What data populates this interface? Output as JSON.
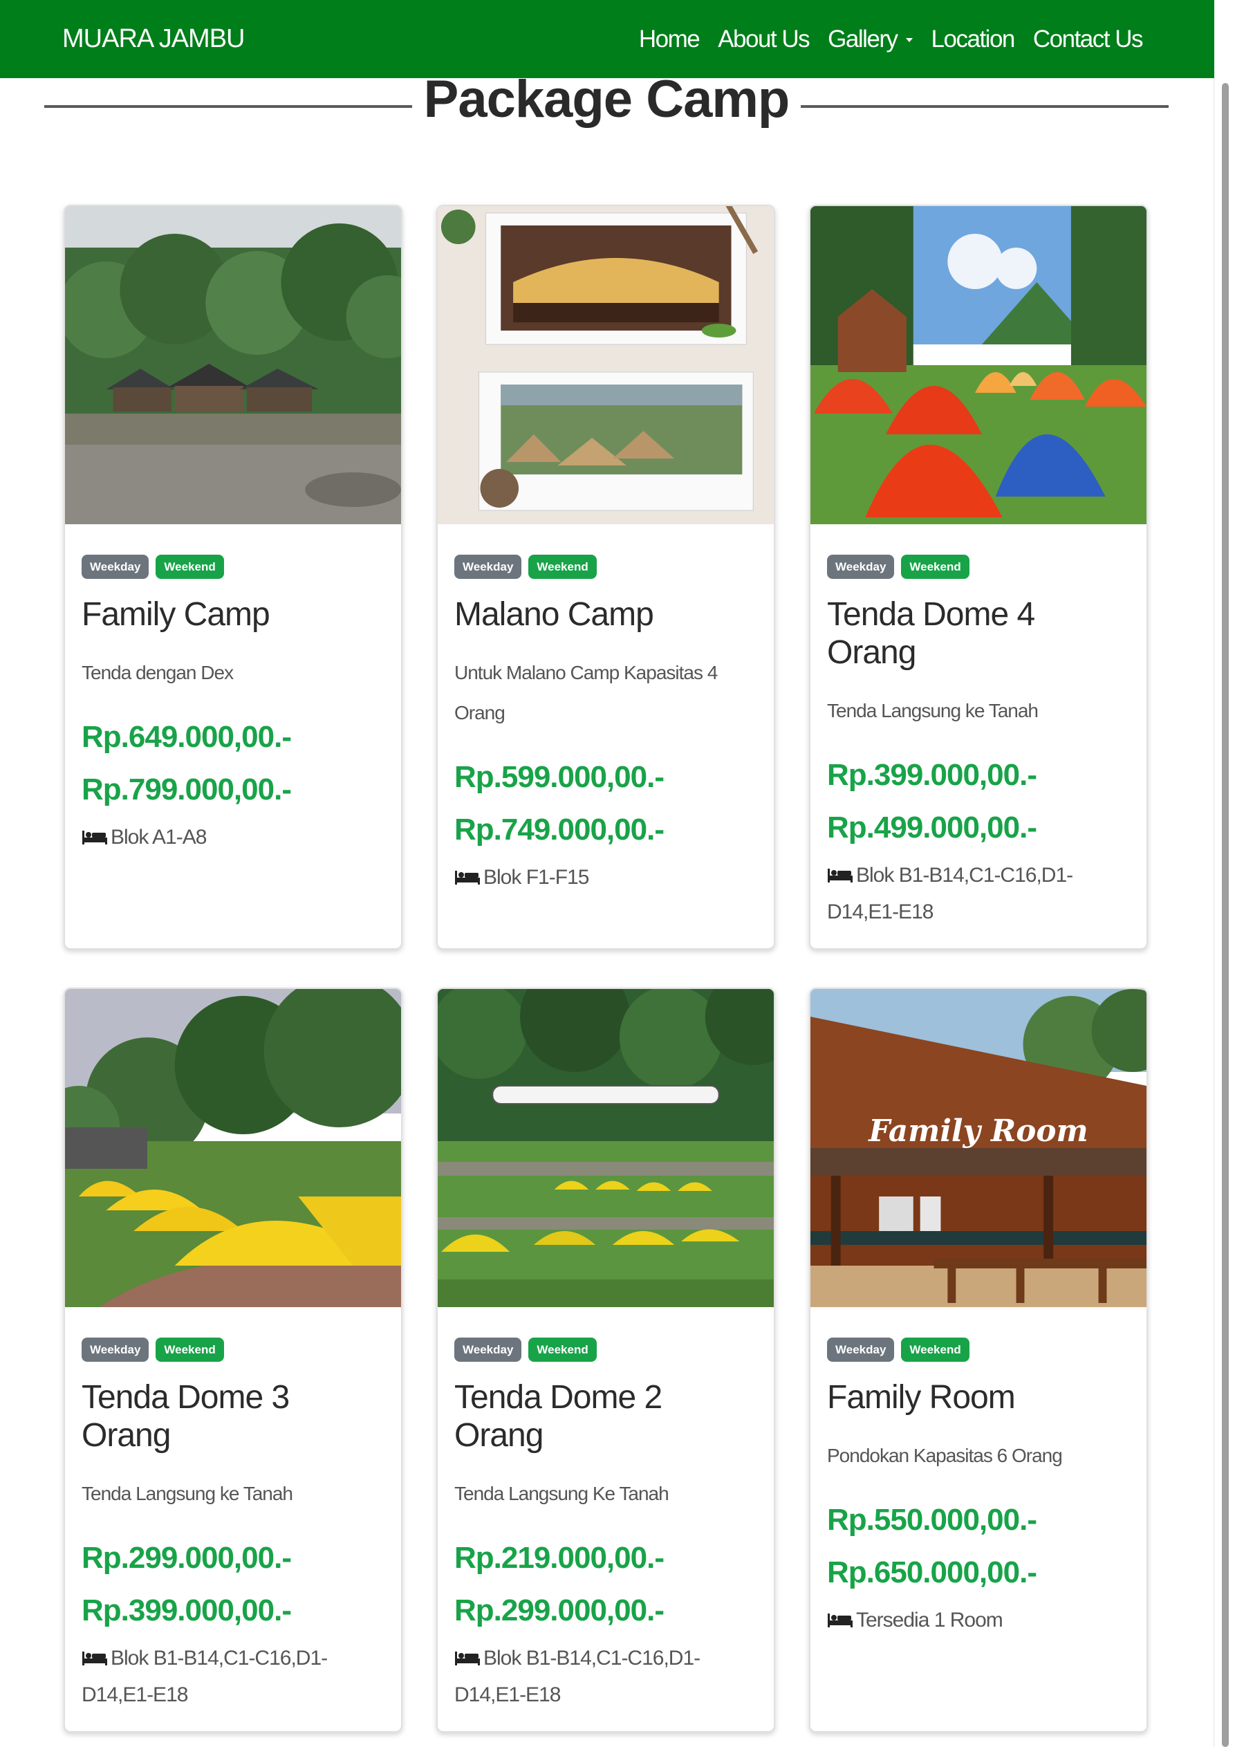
{
  "navbar": {
    "brand": "MUARA JAMBU",
    "links": [
      "Home",
      "About Us",
      "Gallery",
      "Location",
      "Contact Us"
    ]
  },
  "section": {
    "title": "Package Camp"
  },
  "cards": [
    {
      "badge_weekday": "Weekday",
      "badge_weekend": "Weekend",
      "title": "Family Camp",
      "description": "Tenda dengan Dex",
      "price_weekday": "Rp.649.000,00.-",
      "price_weekend": "Rp.799.000,00.-",
      "location": "Blok A1-A8",
      "image": "village-lodge-photo"
    },
    {
      "badge_weekday": "Weekday",
      "badge_weekend": "Weekend",
      "title": "Malano Camp",
      "description": "Untuk Malano Camp Kapasitas 4 Orang",
      "price_weekday": "Rp.599.000,00.-",
      "price_weekend": "Rp.749.000,00.-",
      "location": "Blok F1-F15",
      "image": "tent-collage-photo"
    },
    {
      "badge_weekday": "Weekday",
      "badge_weekend": "Weekend",
      "title": "Tenda Dome 4 Orang",
      "description": "Tenda Langsung ke Tanah",
      "price_weekday": "Rp.399.000,00.-",
      "price_weekend": "Rp.499.000,00.-",
      "location": "Blok B1-B14,C1-C16,D1-D14,E1-E18",
      "image": "orange-tents-photo"
    },
    {
      "badge_weekday": "Weekday",
      "badge_weekend": "Weekend",
      "title": "Tenda Dome 3 Orang",
      "description": "Tenda Langsung ke Tanah",
      "price_weekday": "Rp.299.000,00.-",
      "price_weekend": "Rp.399.000,00.-",
      "location": "Blok B1-B14,C1-C16,D1-D14,E1-E18",
      "image": "yellow-tents-photo"
    },
    {
      "badge_weekday": "Weekday",
      "badge_weekend": "Weekend",
      "title": "Tenda Dome 2 Orang",
      "description": "Tenda Langsung Ke Tanah",
      "price_weekday": "Rp.219.000,00.-",
      "price_weekend": "Rp.299.000,00.-",
      "location": "Blok B1-B14,C1-C16,D1-D14,E1-E18",
      "image": "campground-terraces-photo"
    },
    {
      "badge_weekday": "Weekday",
      "badge_weekend": "Weekend",
      "title": "Family Room",
      "description": "Pondokan Kapasitas 6 Orang",
      "price_weekday": "Rp.550.000,00.-",
      "price_weekend": "Rp.650.000,00.-",
      "location": "Tersedia 1 Room",
      "image": "wooden-cabin-photo",
      "image_sign": "Family Room"
    }
  ],
  "colors": {
    "navbar": "#007e1a",
    "price": "#18a348",
    "badge_weekday": "#6c757d",
    "badge_weekend": "#18a348"
  }
}
